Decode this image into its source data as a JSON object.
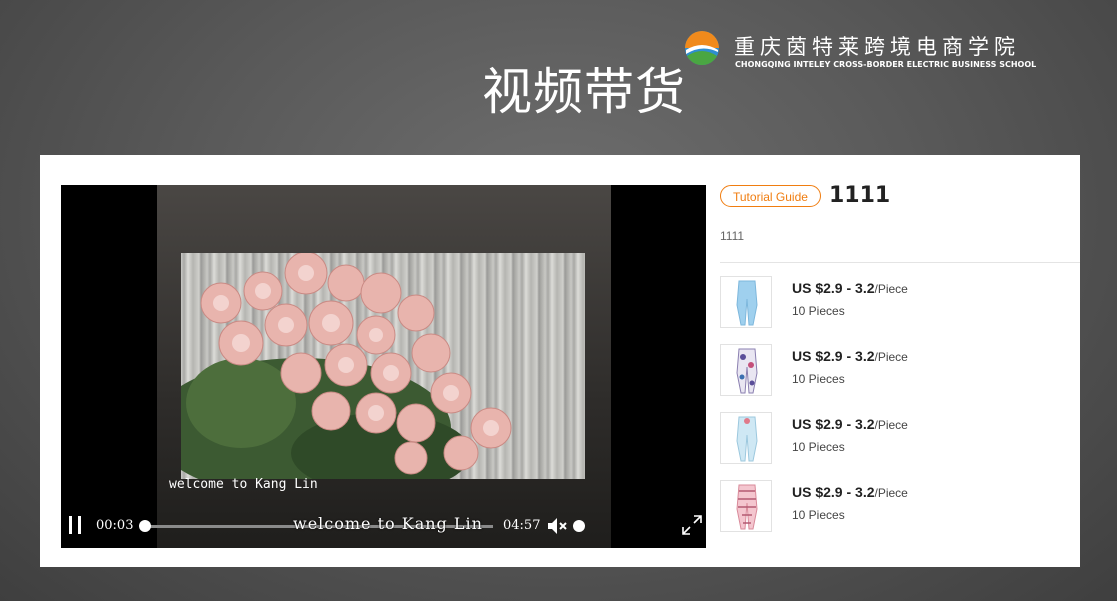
{
  "slide_title": "视频带货",
  "brand": {
    "name_cn": "重庆茵特莱跨境电商学院",
    "name_en": "CHONGQING INTELEY CROSS-BORDER ELECTRIC BUSINESS SCHOOL"
  },
  "video": {
    "subtitle": "welcome to Kang Lin",
    "caption_overlay": "welcome to Kang Lin",
    "current_time": "00:03",
    "total_time": "04:57",
    "progress": 0.01,
    "volume_level": 1.0,
    "state_icon": "pause-icon"
  },
  "product": {
    "tag": "Tutorial Guide",
    "title": "1111",
    "description": "1111"
  },
  "items": [
    {
      "price": "US $2.9 - 3.2",
      "unit": "/Piece",
      "quantity": "10 Pieces",
      "thumb_icon": "light-blue-leggings"
    },
    {
      "price": "US $2.9 - 3.2",
      "unit": "/Piece",
      "quantity": "10 Pieces",
      "thumb_icon": "floral-print-leggings"
    },
    {
      "price": "US $2.9 - 3.2",
      "unit": "/Piece",
      "quantity": "10 Pieces",
      "thumb_icon": "pale-blue-leggings"
    },
    {
      "price": "US $2.9 - 3.2",
      "unit": "/Piece",
      "quantity": "10 Pieces",
      "thumb_icon": "pink-pattern-leggings"
    }
  ],
  "colors": {
    "accent": "#f07d10",
    "panel": "#ffffff",
    "player_bg": "#000000"
  }
}
